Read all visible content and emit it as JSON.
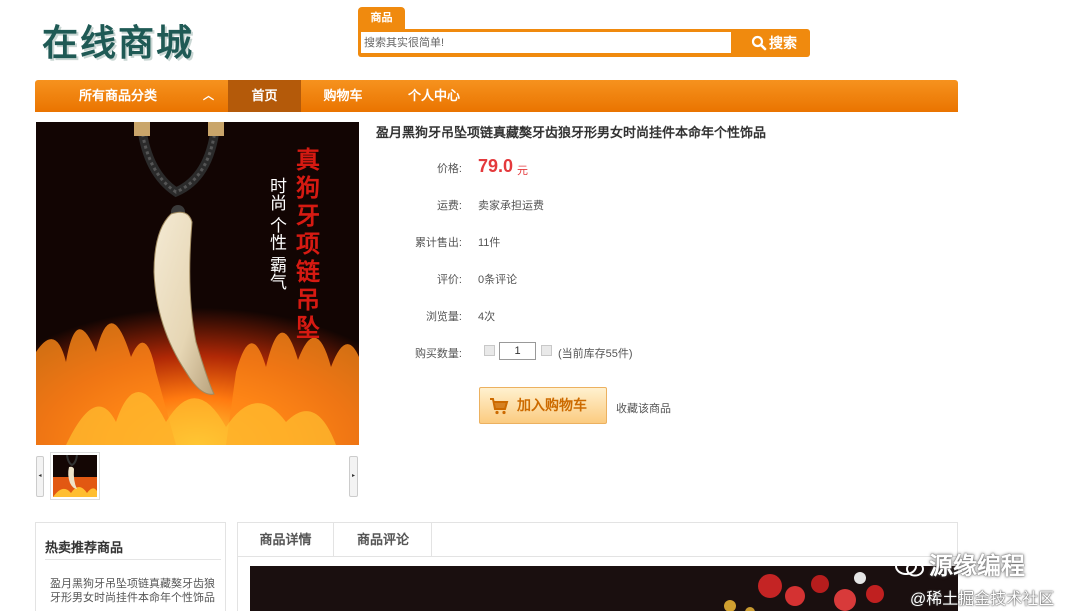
{
  "header": {
    "logo_text": "在线商城",
    "search": {
      "tab_label": "商品",
      "placeholder": "搜索其实很简单!",
      "button_label": "搜索"
    }
  },
  "nav": {
    "category_label": "所有商品分类",
    "items": [
      {
        "label": "首页",
        "active": true
      },
      {
        "label": "购物车",
        "active": false
      },
      {
        "label": "个人中心",
        "active": false
      }
    ]
  },
  "product": {
    "title": "盈月黑狗牙吊坠项链真藏獒牙齿狼牙形男女时尚挂件本命年个性饰品",
    "image_text_left": "时尚 个性 霸气",
    "image_text_right": "真狗牙项链吊坠",
    "price_label": "价格:",
    "price_value": "79.0",
    "price_unit": "元",
    "shipping_label": "运费:",
    "shipping_value": "卖家承担运费",
    "sold_label": "累计售出:",
    "sold_value": "11件",
    "review_label": "评价:",
    "review_value": "0条评论",
    "views_label": "浏览量:",
    "views_value": "4次",
    "qty_label": "购买数量:",
    "qty_value": "1",
    "stock_text": "(当前库存55件)",
    "add_cart_label": "加入购物车",
    "favorite_label": "收藏该商品"
  },
  "hot": {
    "title": "热卖推荐商品",
    "item_text": "盈月黑狗牙吊坠项链真藏獒牙齿狼牙形男女时尚挂件本命年个性饰品"
  },
  "detail_tabs": [
    "商品详情",
    "商品评论"
  ],
  "watermark": {
    "main": "源缘编程",
    "sub": "@稀土掘金技术社区"
  },
  "colors": {
    "accent": "#f08a0e",
    "nav_active": "#b45a0a",
    "price": "#e4393c",
    "logo": "#1f5a55"
  }
}
